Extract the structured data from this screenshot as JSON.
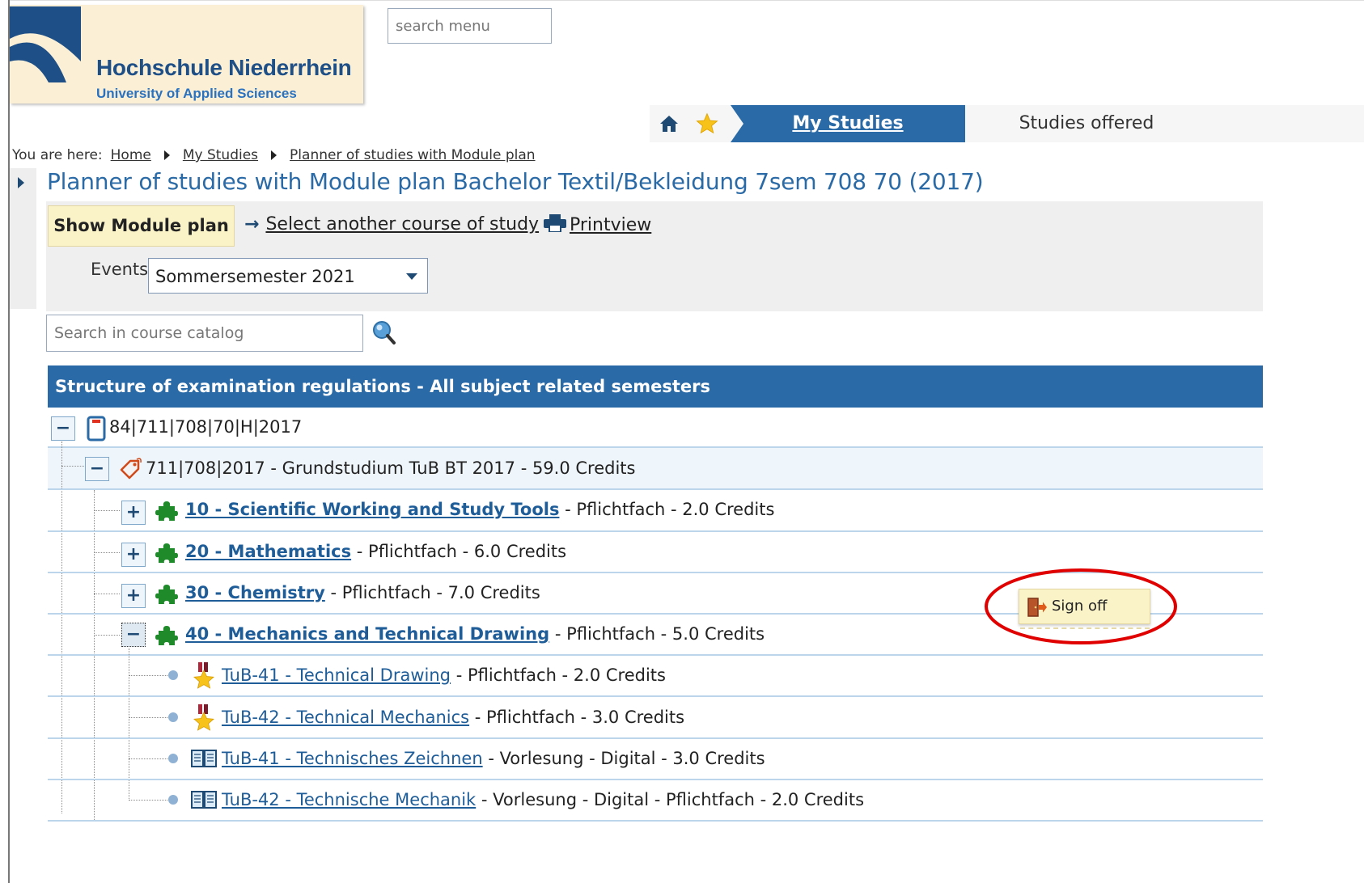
{
  "header": {
    "logo_name": "Hochschule Niederrhein",
    "logo_sub": "University of Applied Sciences",
    "search_menu_placeholder": "search menu"
  },
  "nav": {
    "home_icon": "home-icon",
    "favorites_icon": "star-icon",
    "tabs": [
      {
        "label": "My Studies",
        "active": true
      },
      {
        "label": "Studies offered",
        "active": false
      }
    ],
    "active_color": "#2a6aa6"
  },
  "breadcrumb": {
    "prefix": "You are here:",
    "items": [
      "Home",
      "My Studies",
      "Planner of studies with Module plan"
    ]
  },
  "page": {
    "title": "Planner of studies with Module plan Bachelor Textil/Bekleidung 7sem 708 70 (2017)"
  },
  "toolbar": {
    "show_module_plan": "Show Module plan",
    "select_course": "Select another course of study",
    "printview": "Printview",
    "events_label": "Events",
    "events_value": "Sommersemester 2021",
    "catalog_search_placeholder": "Search in course catalog"
  },
  "tree": {
    "header": "Structure of examination regulations - All subject related semesters",
    "root": {
      "toggle": "−",
      "label": "84|711|708|70|H|2017"
    },
    "grund": {
      "toggle": "−",
      "label": "711|708|2017 - Grundstudium TuB BT 2017 - 59.0 Credits"
    },
    "modules": [
      {
        "toggle": "+",
        "link": "10 - Scientific Working and Study Tools",
        "suffix": " - Pflichtfach - 2.0 Credits"
      },
      {
        "toggle": "+",
        "link": "20 - Mathematics",
        "suffix": " - Pflichtfach - 6.0 Credits"
      },
      {
        "toggle": "+",
        "link": "30 - Chemistry",
        "suffix": " - Pflichtfach - 7.0 Credits"
      },
      {
        "toggle": "−",
        "link": "40 - Mechanics and Technical Drawing",
        "suffix": " - Pflichtfach - 5.0 Credits"
      }
    ],
    "leaves": [
      {
        "icon": "exam-medal-icon",
        "link": "TuB-41 - Technical Drawing",
        "suffix": " - Pflichtfach - 2.0 Credits"
      },
      {
        "icon": "exam-medal-icon",
        "link": "TuB-42 - Technical Mechanics",
        "suffix": " - Pflichtfach - 3.0 Credits"
      },
      {
        "icon": "book-icon",
        "link": "TuB-41 - Technisches Zeichnen",
        "suffix": " - Vorlesung - Digital - 3.0 Credits"
      },
      {
        "icon": "book-icon",
        "link": "TuB-42 - Technische Mechanik",
        "suffix": " - Vorlesung - Digital - Pflichtfach - 2.0 Credits"
      }
    ]
  },
  "popup": {
    "signoff_label": "Sign off",
    "highlight_color": "#e00000"
  }
}
